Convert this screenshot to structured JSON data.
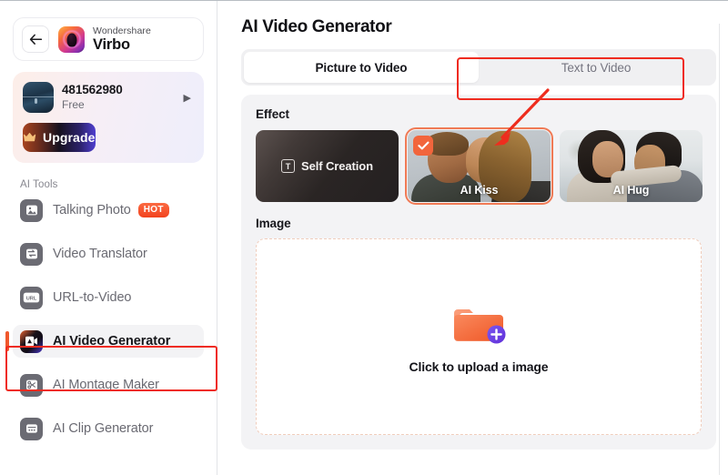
{
  "sidebar": {
    "brand": {
      "back_icon": "arrow-left-icon",
      "logo_icon": "virbo-logo-icon",
      "sub": "Wondershare",
      "name": "Virbo"
    },
    "account": {
      "avatar_icon": "user-avatar",
      "id": "481562980",
      "plan": "Free",
      "chevron_icon": "chevron-right-icon"
    },
    "upgrade": {
      "icon": "crown-icon",
      "label": "Upgrade"
    },
    "section_label": "AI Tools",
    "items": [
      {
        "label": "Talking Photo",
        "icon": "image-portrait-icon",
        "badge": "HOT",
        "active": false
      },
      {
        "label": "Video Translator",
        "icon": "translate-icon",
        "badge": "",
        "active": false
      },
      {
        "label": "URL-to-Video",
        "icon": "url-icon",
        "badge": "",
        "active": false
      },
      {
        "label": "AI Video Generator",
        "icon": "ai-video-icon",
        "badge": "",
        "active": true
      },
      {
        "label": "AI Montage Maker",
        "icon": "scissors-icon",
        "badge": "",
        "active": false
      },
      {
        "label": "AI Clip Generator",
        "icon": "clip-icon",
        "badge": "",
        "active": false
      }
    ]
  },
  "main": {
    "title": "AI Video Generator",
    "tabs": [
      {
        "label": "Picture to Video",
        "active": true
      },
      {
        "label": "Text to Video",
        "active": false
      }
    ],
    "effect": {
      "title": "Effect",
      "cards": [
        {
          "label": "Self Creation",
          "type": "self",
          "selected": false
        },
        {
          "label": "AI Kiss",
          "type": "photo-kiss",
          "selected": true
        },
        {
          "label": "AI Hug",
          "type": "photo-hug",
          "selected": false
        }
      ]
    },
    "image": {
      "title": "Image",
      "upload_icon": "image-upload-plus-icon",
      "upload_text": "Click to upload a image"
    }
  },
  "annotations": {
    "accent_color": "#ef2b20",
    "selection_color": "#f07a55",
    "tab_highlight": "Picture to Video",
    "nav_highlight": "AI Video Generator",
    "arrow_points_to": "AI Kiss"
  }
}
